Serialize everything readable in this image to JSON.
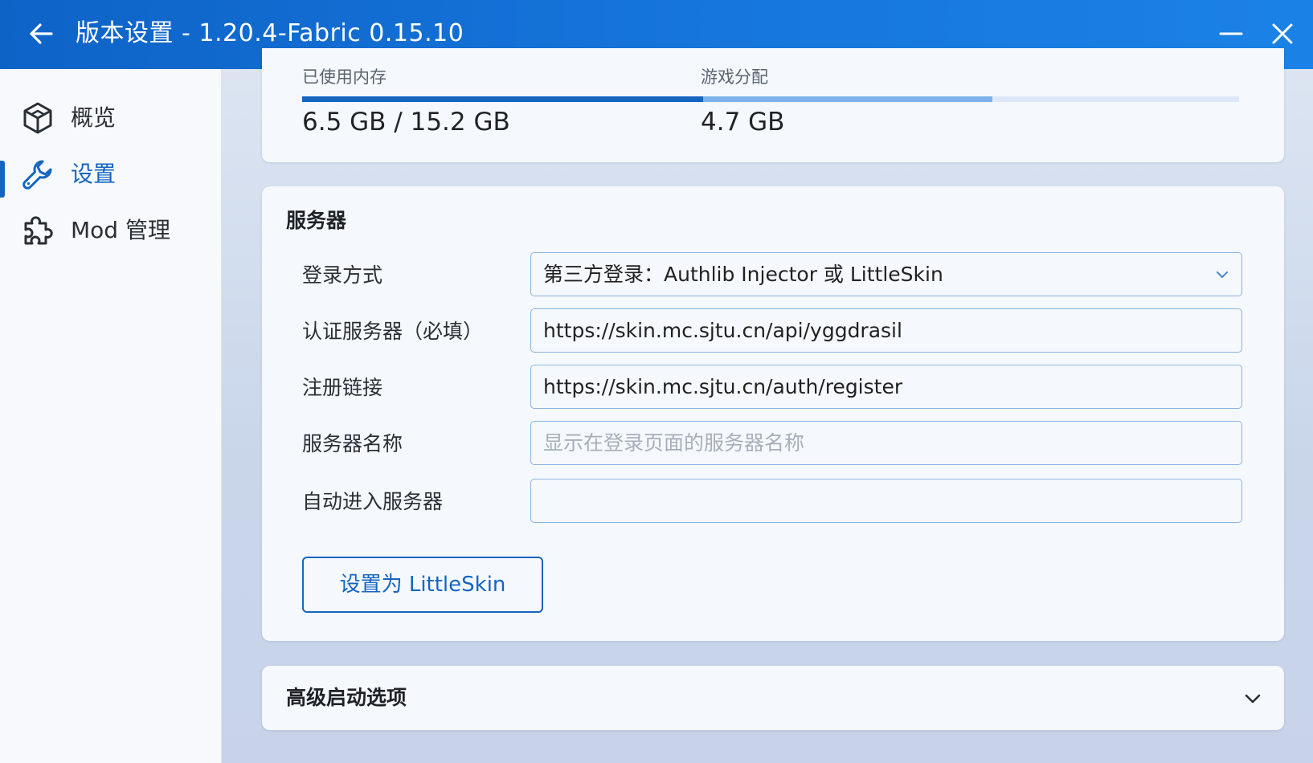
{
  "window": {
    "title": "版本设置 - 1.20.4-Fabric 0.15.10"
  },
  "sidebar": {
    "items": [
      {
        "label": "概览",
        "icon": "cube-icon",
        "active": false
      },
      {
        "label": "设置",
        "icon": "wrench-icon",
        "active": true
      },
      {
        "label": "Mod 管理",
        "icon": "puzzle-icon",
        "active": false
      }
    ]
  },
  "memory": {
    "used_label": "已使用内存",
    "used_value": "6.5 GB / 15.2 GB",
    "alloc_label": "游戏分配",
    "alloc_value": "4.7 GB",
    "used_fraction": 0.428,
    "alloc_fraction": 0.309
  },
  "server": {
    "title": "服务器",
    "login_method_label": "登录方式",
    "login_method_value": "第三方登录：Authlib Injector 或 LittleSkin",
    "auth_server_label": "认证服务器（必填）",
    "auth_server_value": "https://skin.mc.sjtu.cn/api/yggdrasil",
    "register_label": "注册链接",
    "register_value": "https://skin.mc.sjtu.cn/auth/register",
    "server_name_label": "服务器名称",
    "server_name_placeholder": "显示在登录页面的服务器名称",
    "auto_join_label": "自动进入服务器",
    "auto_join_value": "",
    "set_littleskin_button": "设置为 LittleSkin"
  },
  "advanced": {
    "title": "高级启动选项"
  },
  "colors": {
    "accent": "#1565c0",
    "titlebar": "#1676dc",
    "field_border": "#8cb3e0"
  }
}
